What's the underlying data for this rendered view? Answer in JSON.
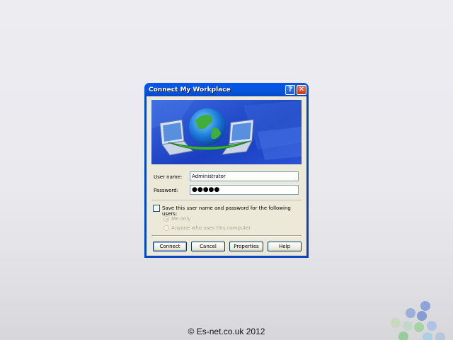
{
  "window": {
    "title": "Connect My Workplace",
    "help_glyph": "?",
    "close_glyph": "✕"
  },
  "form": {
    "username_label": "User name:",
    "username_value": "Administrator",
    "password_label": "Password:",
    "password_value": "●●●●●",
    "save_label": "Save this user name and password for the following users:",
    "radio_me_only": "Me only",
    "radio_anyone": "Anyone who uses this computer",
    "save_checked": false,
    "selected_radio": "Me only"
  },
  "buttons": {
    "connect": "Connect",
    "cancel": "Cancel",
    "properties": "Properties",
    "help": "Help"
  },
  "footer": {
    "copyright": "© Es-net.co.uk 2012"
  },
  "colors": {
    "titlebar": "#0054e3",
    "client": "#ece9d8",
    "banner": "#1c46c4"
  }
}
